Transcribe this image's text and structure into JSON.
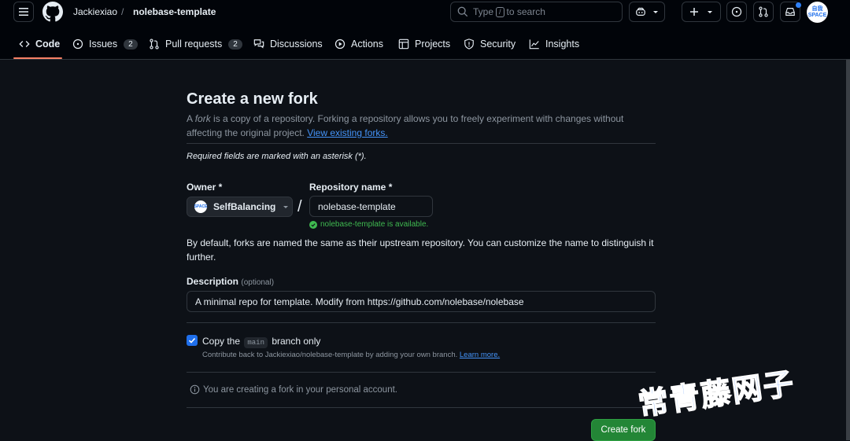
{
  "header": {
    "owner": "Jackiexiao",
    "separator": "/",
    "repo": "nolebase-template",
    "search": {
      "prefix": "Type",
      "key": "/",
      "suffix": "to search"
    },
    "avatar_text": [
      "自我",
      "SPACE"
    ]
  },
  "tabs": [
    {
      "label": "Code"
    },
    {
      "label": "Issues",
      "count": "2"
    },
    {
      "label": "Pull requests",
      "count": "2"
    },
    {
      "label": "Discussions"
    },
    {
      "label": "Actions"
    },
    {
      "label": "Projects"
    },
    {
      "label": "Security"
    },
    {
      "label": "Insights"
    }
  ],
  "form": {
    "title": "Create a new fork",
    "subtitle_a": "A ",
    "subtitle_em": "fork",
    "subtitle_b": " is a copy of a repository. Forking a repository allows you to freely experiment with changes without affecting the original project. ",
    "subtitle_link": "View existing forks.",
    "required_note": "Required fields are marked with an asterisk (*).",
    "owner_label": "Owner *",
    "owner_value": "SelfBalancing",
    "owner_avatar_text": "SPACE",
    "slash": "/",
    "repo_label": "Repository name *",
    "repo_value": "nolebase-template",
    "availability": "nolebase-template is available.",
    "default_note": "By default, forks are named the same as their upstream repository. You can customize the name to distinguish it further.",
    "description_label": "Description",
    "description_optional": "(optional)",
    "description_value": "A minimal repo for template. Modify from https://github.com/nolebase/nolebase",
    "copy_prefix": "Copy the",
    "copy_branch": "main",
    "copy_suffix": "branch only",
    "copy_help": "Contribute back to Jackiexiao/nolebase-template by adding your own branch.",
    "copy_help_link": "Learn more.",
    "info": "You are creating a fork in your personal account.",
    "create_button": "Create fork"
  },
  "watermark": "常青藤网子",
  "colors": {
    "accent": "#1f6feb",
    "success": "#238636",
    "tab_underline": "#f78166",
    "link": "#4493f8"
  }
}
